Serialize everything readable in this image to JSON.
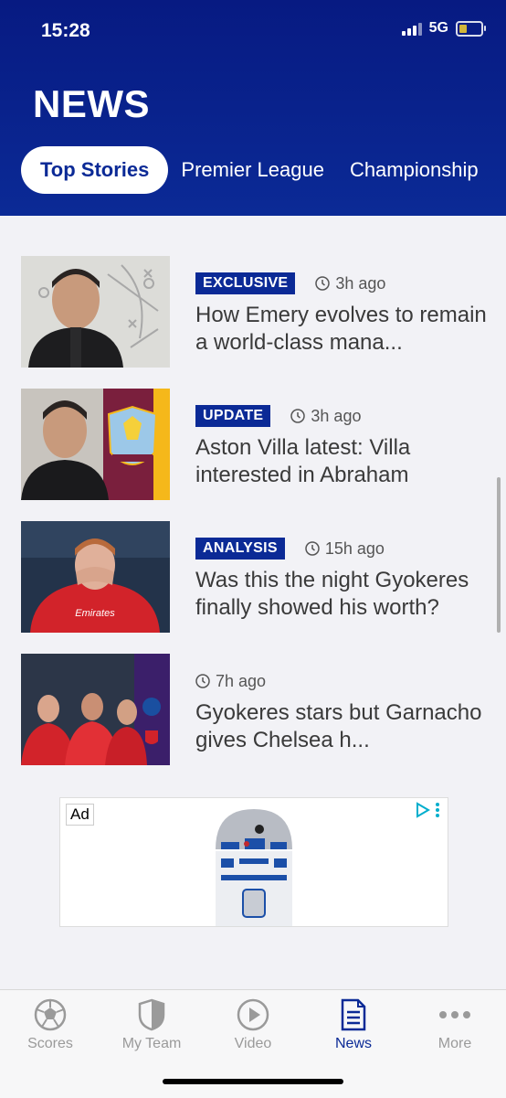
{
  "status": {
    "time": "15:28",
    "network": "5G"
  },
  "header": {
    "title": "NEWS"
  },
  "tabs": [
    {
      "label": "Top Stories",
      "active": true
    },
    {
      "label": "Premier League",
      "active": false
    },
    {
      "label": "Championship",
      "active": false
    }
  ],
  "articles": [
    {
      "badge": "EXCLUSIVE",
      "time": "3h ago",
      "headline": "How Emery evolves to remain a world-class mana..."
    },
    {
      "badge": "UPDATE",
      "time": "3h ago",
      "headline": "Aston Villa latest: Villa interested in Abraham"
    },
    {
      "badge": "ANALYSIS",
      "time": "15h ago",
      "headline": "Was this the night Gyokeres finally showed his worth?"
    },
    {
      "badge": "",
      "time": "7h ago",
      "headline": "Gyokeres stars but Garnacho gives Chelsea h..."
    }
  ],
  "ad": {
    "label": "Ad"
  },
  "bottom_nav": [
    {
      "label": "Scores",
      "icon": "football-icon",
      "active": false
    },
    {
      "label": "My Team",
      "icon": "shield-icon",
      "active": false
    },
    {
      "label": "Video",
      "icon": "play-icon",
      "active": false
    },
    {
      "label": "News",
      "icon": "document-icon",
      "active": true
    },
    {
      "label": "More",
      "icon": "more-dots-icon",
      "active": false
    }
  ],
  "colors": {
    "brand_blue": "#0b2a96",
    "header_dark": "#071a82",
    "arsenal_red": "#d2232a",
    "villa_claret": "#7a1f3d"
  }
}
